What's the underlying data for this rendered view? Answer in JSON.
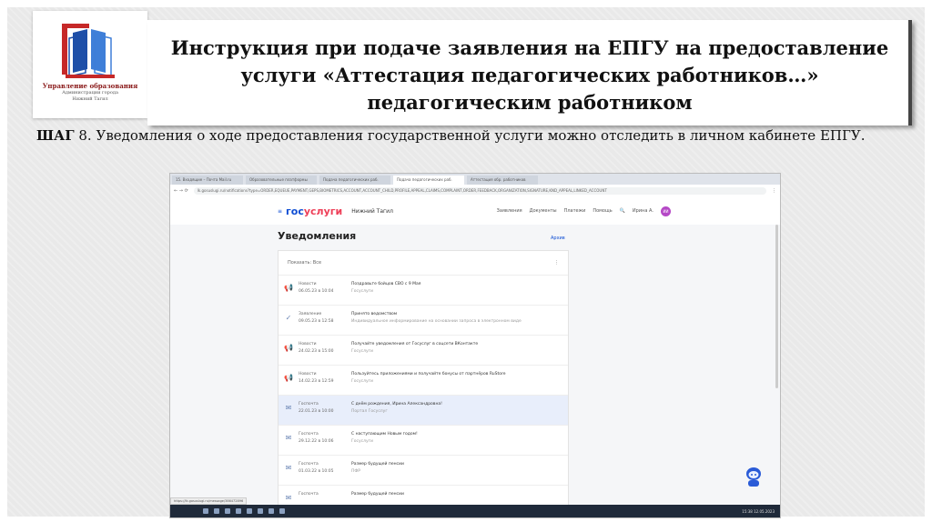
{
  "logo": {
    "line1": "Управление образования",
    "line2": "Администрации города",
    "line3": "Нижний Тагил"
  },
  "title": "Инструкция при подаче заявления на ЕПГУ на предоставление услуги «Аттестация педагогических работников…» педагогическим работником",
  "step": {
    "label": "ШАГ",
    "number": "8.",
    "text": "Уведомления о ходе предоставления государственной услуги можно отследить в личном кабинете ЕПГУ."
  },
  "browser": {
    "tabs": [
      "15. Входящие – Почта Mail.ru",
      "Образовательные платформы",
      "Подача педагогических раб.",
      "Подача педагогических раб.",
      "Аттестация обр. работников"
    ],
    "url": "lk.gosuslugi.ru/notifications?type=ORDER,EQUEUE,PAYMENT,GEPS,BIOMETRICS,ACCOUNT,ACCOUNT_CHILD,PROFILE,APPEAL,CLAIMS,COMPLAINT,ORDER,FEEDBACK,ORGANIZATION,SIGNATURE,KND_APPEAL,LINKED_ACCOUNT"
  },
  "gosuslugi": {
    "brand_a": "гос",
    "brand_b": "услуги",
    "location": "Нижний Тагил",
    "nav": [
      "Заявления",
      "Документы",
      "Платежи",
      "Помощь"
    ],
    "user": "Ирина А.",
    "avatar": "ИИ",
    "page_title": "Уведомления",
    "archive": "Архив",
    "show_all": "Показать: Все",
    "notifications": [
      {
        "icon": "megaphone-icon",
        "glyph": "📢",
        "category": "Новости",
        "date": "06.05.23 в 10:04",
        "title": "Поздравьте бойцов СВО с 9 Мая",
        "sub": "Госуслуги",
        "highlight": false
      },
      {
        "icon": "check-icon",
        "glyph": "✓",
        "category": "Заявление",
        "date": "09.05.23 в 12:58",
        "title": "Принято ведомством",
        "sub": "Индивидуальное информирование на основании запроса в электронном виде",
        "highlight": false
      },
      {
        "icon": "megaphone-icon",
        "glyph": "📢",
        "category": "Новости",
        "date": "24.02.23 в 15:00",
        "title": "Получайте уведомления от Госуслуг в соцсети ВКонтакте",
        "sub": "Госуслуги",
        "highlight": false
      },
      {
        "icon": "megaphone-icon",
        "glyph": "📢",
        "category": "Новости",
        "date": "14.02.23 в 12:59",
        "title": "Пользуйтесь приложениями и получайте бонусы от партнёров RuStore",
        "sub": "Госуслуги",
        "highlight": false
      },
      {
        "icon": "envelope-icon",
        "glyph": "✉",
        "category": "Госпочта",
        "date": "22.01.23 в 10:00",
        "title": "С днём рождения, Ирина Александровна!",
        "sub": "Портал Госуслуг",
        "highlight": true
      },
      {
        "icon": "envelope-icon",
        "glyph": "✉",
        "category": "Госпочта",
        "date": "29.12.22 в 10:06",
        "title": "С наступающим Новым годом!",
        "sub": "Госуслуги",
        "highlight": false
      },
      {
        "icon": "envelope-icon",
        "glyph": "✉",
        "category": "Госпочта",
        "date": "01.03.22 в 10:05",
        "title": "Размер будущей пенсии",
        "sub": "ПФР",
        "highlight": false
      },
      {
        "icon": "envelope-icon",
        "glyph": "✉",
        "category": "Госпочта",
        "date": "",
        "title": "Размер будущей пенсии",
        "sub": "",
        "highlight": false
      }
    ]
  },
  "taskbar": {
    "clock": "15:38\n12.05.2023",
    "status_url": "https://lk.gosuslugi.ru/message/386472896"
  },
  "colors": {
    "brand_blue": "#0d4cd3",
    "brand_red": "#ee3f58",
    "highlight": "#e8eefb"
  }
}
